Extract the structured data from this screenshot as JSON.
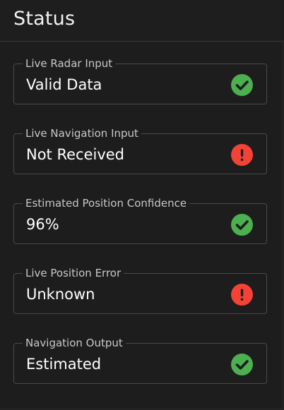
{
  "header": {
    "title": "Status"
  },
  "fields": [
    {
      "label": "Live Radar Input",
      "value": "Valid Data",
      "status": "ok",
      "icon": "check-circle-icon"
    },
    {
      "label": "Live Navigation Input",
      "value": "Not Received",
      "status": "error",
      "icon": "error-circle-icon"
    },
    {
      "label": "Estimated Position Confidence",
      "value": "96%",
      "status": "ok",
      "icon": "check-circle-icon"
    },
    {
      "label": "Live Position Error",
      "value": "Unknown",
      "status": "error",
      "icon": "error-circle-icon"
    },
    {
      "label": "Navigation Output",
      "value": "Estimated",
      "status": "ok",
      "icon": "check-circle-icon"
    }
  ],
  "colors": {
    "ok": "#4caf50",
    "error": "#f44336",
    "background": "#1d1d1d",
    "border": "#4a4a4a"
  }
}
